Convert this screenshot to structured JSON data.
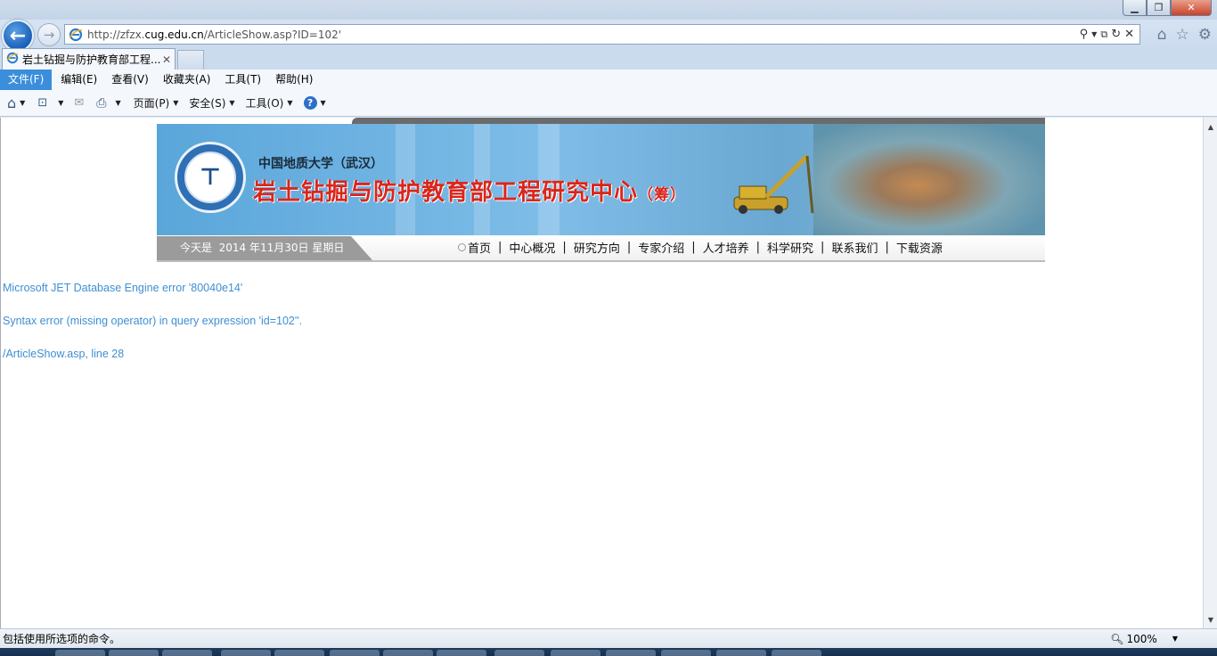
{
  "browser": {
    "address": {
      "url_prefix": "http://zfzx.",
      "url_domain": "cug.edu.cn",
      "url_path": "/ArticleShow.asp?ID=102'"
    },
    "tab": {
      "title": "岩土钻掘与防护教育部工程...",
      "close": "✕"
    },
    "menu": [
      "文件(F)",
      "编辑(E)",
      "查看(V)",
      "收藏夹(A)",
      "工具(T)",
      "帮助(H)"
    ],
    "commands": {
      "page": "页面(P)",
      "safety": "安全(S)",
      "tools": "工具(O)"
    },
    "status": "包括使用所选项的命令。",
    "zoom": "100%",
    "colors": {
      "menu_active": "#3b8edc",
      "error_text": "#3f8fd2",
      "banner_title": "#d9261c"
    }
  },
  "site": {
    "university": "中国地质大学（武汉）",
    "center_title": "岩土钻掘与防护教育部工程研究中心",
    "center_suffix": "（筹）",
    "date_prefix": "今天是",
    "date": "2014 年11月30日  星期日",
    "nav": [
      "首页",
      "中心概况",
      "研究方向",
      "专家介绍",
      "人才培养",
      "科学研究",
      "联系我们",
      "下载资源"
    ]
  },
  "error": {
    "line1": "Microsoft JET Database Engine  error '80040e14'",
    "line2": "Syntax error (missing operator) in query expression 'id=102''.",
    "line3": "/ArticleShow.asp, line 28"
  }
}
